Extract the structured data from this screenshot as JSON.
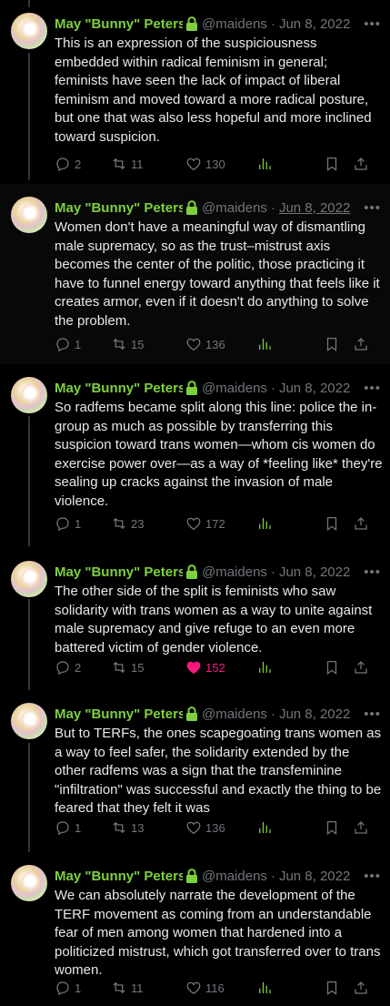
{
  "tweets": [
    {
      "name": "May \"Bunny\" Peters",
      "handle": "@maidens",
      "date": "Jun 8, 2022",
      "text": "This is an expression of the suspiciousness embedded within radical feminism in general; feminists have seen the lack of impact of liberal feminism and moved toward a more radical posture, but one that was also less hopeful and more inclined toward suspicion.",
      "replies": "2",
      "reposts": "11",
      "likes": "130"
    },
    {
      "name": "May \"Bunny\" Peters",
      "handle": "@maidens",
      "date": "Jun 8, 2022",
      "text": "Women don't have a meaningful way of dismantling male supremacy, so as the trust–mistrust axis becomes the center of the politic, those practicing it have to funnel energy toward anything that feels like it creates armor, even if it doesn't do anything to solve the problem.",
      "replies": "1",
      "reposts": "15",
      "likes": "136"
    },
    {
      "name": "May \"Bunny\" Peters",
      "handle": "@maidens",
      "date": "Jun 8, 2022",
      "text": "So radfems became split along this line: police the in-group as much as possible by transferring this suspicion toward trans women—whom cis women do exercise power over—as a way of *feeling like* they're sealing up cracks against the invasion of male violence.",
      "replies": "1",
      "reposts": "23",
      "likes": "172"
    },
    {
      "name": "May \"Bunny\" Peters",
      "handle": "@maidens",
      "date": "Jun 8, 2022",
      "text": "The other side of the split is feminists who saw solidarity with trans women as a way to unite against male supremacy and give refuge to an even more battered victim of gender violence.",
      "replies": "2",
      "reposts": "15",
      "likes": "152"
    },
    {
      "name": "May \"Bunny\" Peters",
      "handle": "@maidens",
      "date": "Jun 8, 2022",
      "text": "But to TERFs, the ones scapegoating trans women as a way to feel safer, the solidarity extended by the other radfems was a sign that the transfeminine \"infiltration\" was successful and exactly the thing to be feared that they felt it was",
      "replies": "1",
      "reposts": "13",
      "likes": "136"
    },
    {
      "name": "May \"Bunny\" Peters",
      "handle": "@maidens",
      "date": "Jun 8, 2022",
      "text": "We can absolutely narrate the development of the TERF movement as coming from an understandable fear of men among women that hardened into a politicized mistrust, which got transferred over to trans women.",
      "replies": "1",
      "reposts": "11",
      "likes": "116"
    }
  ],
  "colors": {
    "name": "#7fcf3e",
    "muted": "#71767b",
    "like_active": "#f91880",
    "background": "#000000"
  },
  "icons": [
    "lock-icon",
    "more-icon",
    "reply-icon",
    "repost-icon",
    "like-icon",
    "views-icon",
    "bookmark-icon",
    "share-icon"
  ]
}
